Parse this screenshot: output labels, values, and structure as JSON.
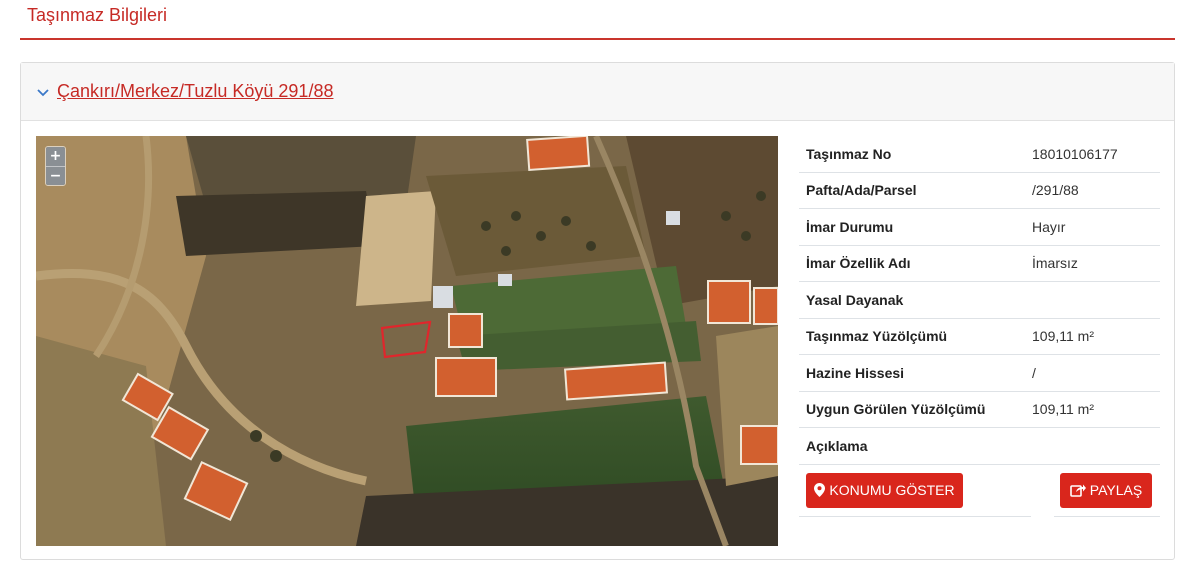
{
  "page": {
    "title": "Taşınmaz Bilgileri"
  },
  "card": {
    "header_link": "Çankırı/Merkez/Tuzlu Köyü 291/88",
    "chevron_icon": "chevron-down-icon",
    "accent_color": "#c62a25"
  },
  "map": {
    "zoom_in_label": "+",
    "zoom_out_label": "−"
  },
  "property": {
    "rows": [
      {
        "label": "Taşınmaz No",
        "value": "18010106177"
      },
      {
        "label": "Pafta/Ada/Parsel",
        "value": "/291/88"
      },
      {
        "label": "İmar Durumu",
        "value": "Hayır"
      },
      {
        "label": "İmar Özellik Adı",
        "value": "İmarsız"
      },
      {
        "label": "Yasal Dayanak",
        "value": ""
      },
      {
        "label": "Taşınmaz Yüzölçümü",
        "value": "109,11 m²"
      },
      {
        "label": "Hazine Hissesi",
        "value": "/"
      },
      {
        "label": "Uygun Görülen Yüzölçümü",
        "value": "109,11 m²"
      },
      {
        "label": "Açıklama",
        "value": ""
      }
    ]
  },
  "actions": {
    "show_location_label": "KONUMU GÖSTER",
    "share_label": "PAYLAŞ",
    "button_color": "#d9261c"
  }
}
